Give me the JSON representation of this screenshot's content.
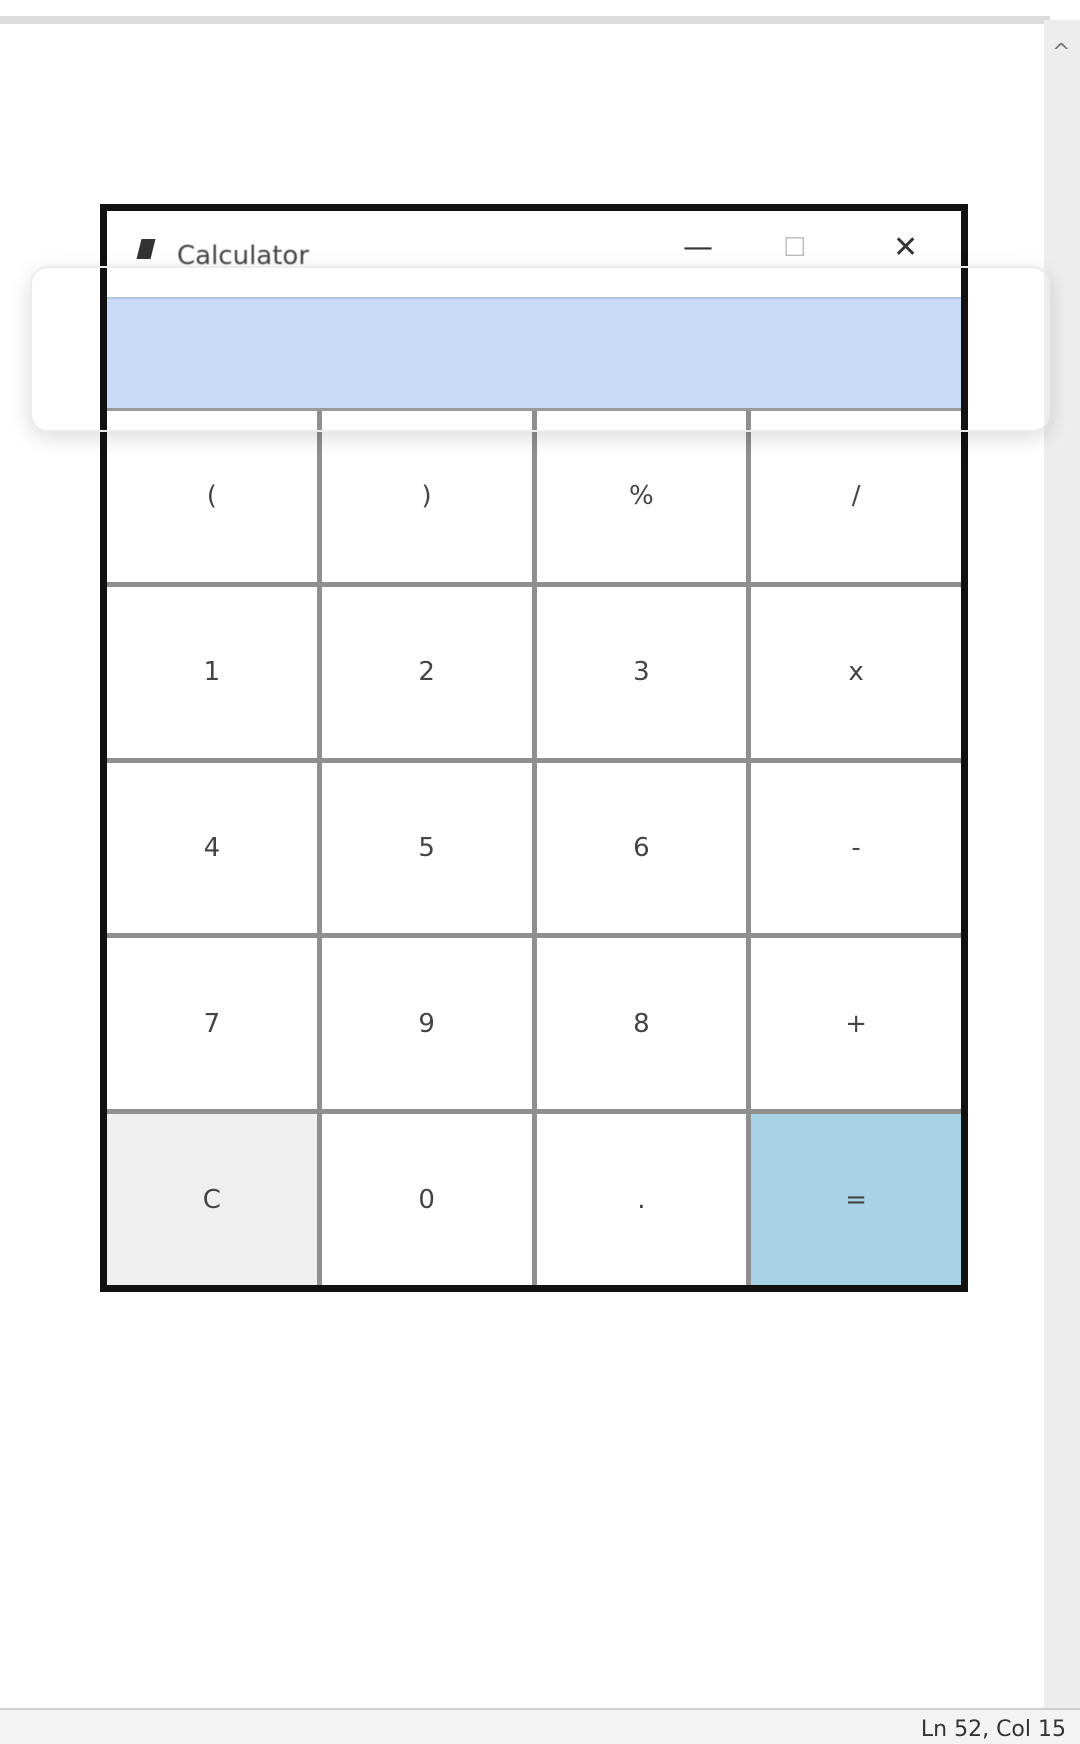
{
  "window": {
    "title": "Calculator",
    "minimize_glyph": "—",
    "maximize_glyph": "☐",
    "close_glyph": "✕"
  },
  "display": {
    "value": ""
  },
  "keys": [
    {
      "label": "(",
      "name": "key-open-paren"
    },
    {
      "label": ")",
      "name": "key-close-paren"
    },
    {
      "label": "%",
      "name": "key-percent"
    },
    {
      "label": "/",
      "name": "key-divide"
    },
    {
      "label": "1",
      "name": "key-1"
    },
    {
      "label": "2",
      "name": "key-2"
    },
    {
      "label": "3",
      "name": "key-3"
    },
    {
      "label": "x",
      "name": "key-multiply"
    },
    {
      "label": "4",
      "name": "key-4"
    },
    {
      "label": "5",
      "name": "key-5"
    },
    {
      "label": "6",
      "name": "key-6"
    },
    {
      "label": "-",
      "name": "key-subtract"
    },
    {
      "label": "7",
      "name": "key-7"
    },
    {
      "label": "9",
      "name": "key-9"
    },
    {
      "label": "8",
      "name": "key-8"
    },
    {
      "label": "+",
      "name": "key-add"
    },
    {
      "label": "C",
      "name": "key-clear"
    },
    {
      "label": "0",
      "name": "key-0"
    },
    {
      "label": ".",
      "name": "key-decimal"
    },
    {
      "label": "=",
      "name": "key-equals"
    }
  ],
  "status": {
    "position": "Ln 52, Col 15"
  },
  "colors": {
    "display_bg": "#c9dcf7",
    "equals_bg": "#a8d3e7",
    "clear_bg": "#efefef",
    "grid_lines": "#8f8f8f"
  }
}
